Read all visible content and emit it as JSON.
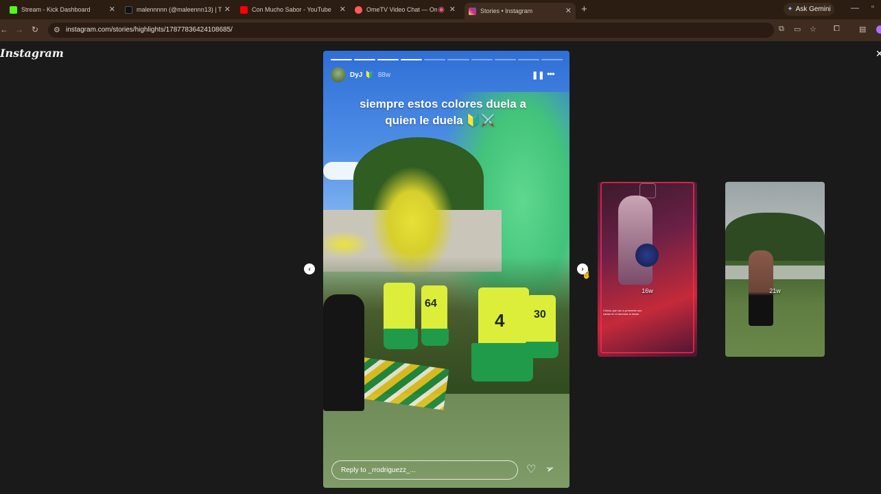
{
  "browser": {
    "tabs": [
      {
        "title": "Stream - Kick Dashboard",
        "favicon_color": "#53fc18"
      },
      {
        "title": "malennnnn (@maleennn13) | T",
        "favicon_color": "#111111"
      },
      {
        "title": "Con Mucho Sabor - YouTube",
        "favicon_color": "#ff0000"
      },
      {
        "title": "OmeTV Video Chat — Ome",
        "favicon_color": "#ff5a5a"
      },
      {
        "title": "Stories • Instagram",
        "favicon_color": "#d62976"
      }
    ],
    "gemini_label": "Ask Gemini",
    "url": "instagram.com/stories/highlights/17877836424108685/"
  },
  "instagram": {
    "logo": "Instagram"
  },
  "story": {
    "progress_total": 10,
    "progress_done": 4,
    "username": "DyJ",
    "badge": "🔰",
    "time": "88w",
    "caption_line1": "siempre estos colores duela a",
    "caption_line2": "quien le duela 🔰⚔️",
    "jersey_numbers": [
      "64",
      "4",
      "30"
    ],
    "reply_placeholder": "Reply to _rrodriguezz_..."
  },
  "previews": [
    {
      "time": "16w",
      "caption": "Chicos que van a presentar sus cartas en el lacrosse lo haran"
    },
    {
      "time": "21w"
    }
  ],
  "icons": {
    "pause": "pause-icon",
    "more": "more-icon",
    "heart": "heart-icon",
    "send": "send-icon"
  }
}
